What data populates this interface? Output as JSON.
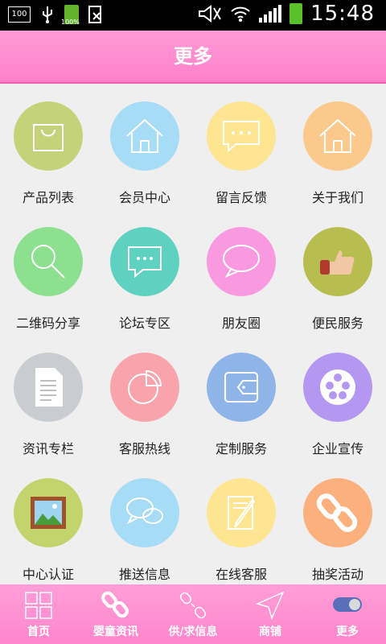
{
  "status_bar": {
    "left_box_text": "100",
    "battery_small_text": "100%",
    "time": "15:48"
  },
  "header": {
    "title": "更多"
  },
  "grid": {
    "items": [
      {
        "label": "产品列表",
        "icon": "shopping-bag-icon",
        "color": "#c4d37a"
      },
      {
        "label": "会员中心",
        "icon": "home-icon",
        "color": "#a6dcf6"
      },
      {
        "label": "留言反馈",
        "icon": "message-box-icon",
        "color": "#fde591"
      },
      {
        "label": "关于我们",
        "icon": "home-icon",
        "color": "#fcc98c"
      },
      {
        "label": "二维码分享",
        "icon": "magnifier-icon",
        "color": "#8ee091"
      },
      {
        "label": "论坛专区",
        "icon": "chat-bubble-icon",
        "color": "#5fd1c1"
      },
      {
        "label": "朋友圈",
        "icon": "speech-bubble-icon",
        "color": "#f99ae0"
      },
      {
        "label": "便民服务",
        "icon": "thumbs-up-icon",
        "color": "#b7bd4e"
      },
      {
        "label": "资讯专栏",
        "icon": "document-icon",
        "color": "#c9ccd1"
      },
      {
        "label": "客服热线",
        "icon": "pie-chart-icon",
        "color": "#f9a4ad"
      },
      {
        "label": "定制服务",
        "icon": "wallet-icon",
        "color": "#8fb4e8"
      },
      {
        "label": "企业宣传",
        "icon": "film-reel-icon",
        "color": "#b497f0"
      },
      {
        "label": "中心认证",
        "icon": "picture-frame-icon",
        "color": "#c2d46b"
      },
      {
        "label": "推送信息",
        "icon": "chat-bubbles-icon",
        "color": "#a6dcf6"
      },
      {
        "label": "在线客服",
        "icon": "notepad-icon",
        "color": "#fde591"
      },
      {
        "label": "抽奖活动",
        "icon": "chain-link-icon",
        "color": "#fcb07d"
      }
    ]
  },
  "bottom_nav": {
    "tabs": [
      {
        "label": "首页",
        "icon": "grid-icon"
      },
      {
        "label": "婴童资讯",
        "icon": "chain-link-icon"
      },
      {
        "label": "供/求信息",
        "icon": "broken-link-icon"
      },
      {
        "label": "商铺",
        "icon": "navigation-arrow-icon"
      },
      {
        "label": "更多",
        "icon": "toggle-icon"
      }
    ]
  }
}
